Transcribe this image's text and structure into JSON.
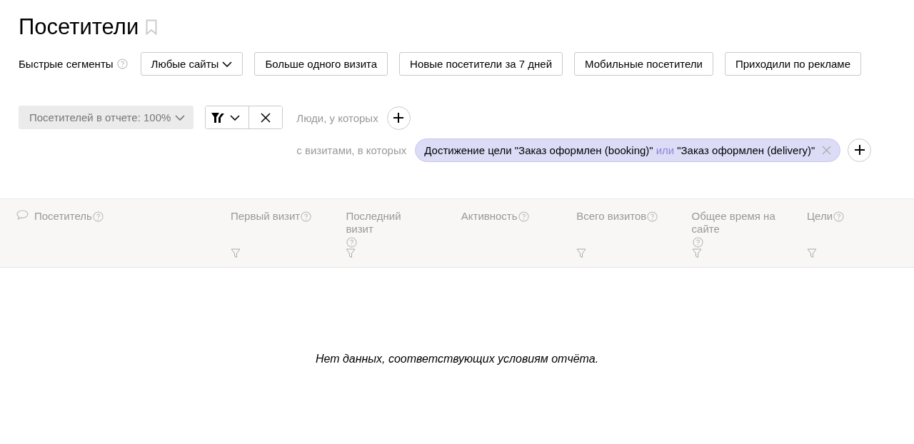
{
  "title": "Посетители",
  "quick_segments": {
    "label": "Быстрые сегменты",
    "buttons": [
      {
        "label": "Любые сайты",
        "kind": "dropdown"
      },
      {
        "label": "Больше одного визита",
        "kind": "button"
      },
      {
        "label": "Новые посетители за 7 дней",
        "kind": "button"
      },
      {
        "label": "Мобильные посетители",
        "kind": "button"
      },
      {
        "label": "Приходили по рекламе",
        "kind": "button"
      }
    ]
  },
  "sampling": {
    "label": "Посетителей в отчете: 100%"
  },
  "conditions": [
    {
      "label": "Люди, у которых"
    },
    {
      "label": "с визитами, в которых",
      "chips": [
        {
          "first": "Достижение цели \"Заказ оформлен (booking)\"",
          "connector": "или",
          "second": "\"Заказ оформлен (delivery)\""
        }
      ]
    }
  ],
  "table": {
    "columns": [
      {
        "label": "Посетитель",
        "filterable": false,
        "comment_icon": true
      },
      {
        "label": "Первый визит",
        "filterable": true,
        "comment_icon": false
      },
      {
        "label": "Последний визит",
        "filterable": true,
        "comment_icon": false
      },
      {
        "label": "Активность",
        "filterable": false,
        "comment_icon": false
      },
      {
        "label": "Всего визитов",
        "filterable": true,
        "comment_icon": false
      },
      {
        "label": "Общее время на сайте",
        "filterable": true,
        "comment_icon": false
      },
      {
        "label": "Цели",
        "filterable": true,
        "comment_icon": false
      }
    ],
    "empty_message": "Нет данных, соответствующих условиям отчёта."
  }
}
